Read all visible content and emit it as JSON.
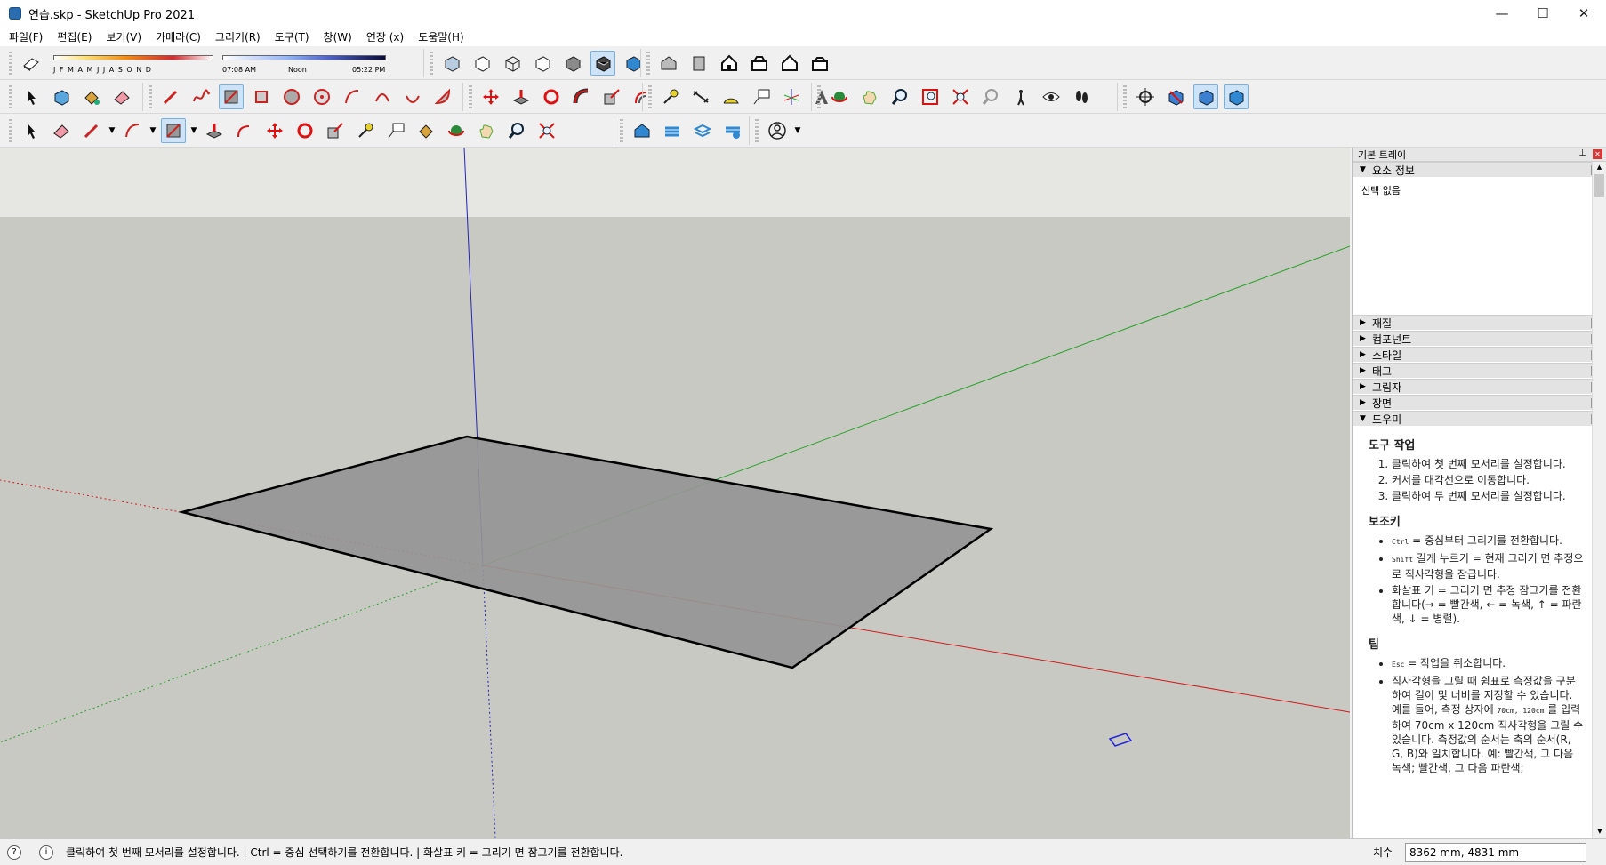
{
  "window": {
    "title": "연습.skp - SketchUp Pro 2021",
    "minimize": "—",
    "maximize": "☐",
    "close": "✕"
  },
  "menu": [
    "파일(F)",
    "편집(E)",
    "보기(V)",
    "카메라(C)",
    "그리기(R)",
    "도구(T)",
    "창(W)",
    "연장 (x)",
    "도움말(H)"
  ],
  "shadow": {
    "months": "J F M A M J J A S O N D",
    "time_start": "07:08 AM",
    "time_mid": "Noon",
    "time_end": "05:22 PM"
  },
  "tray": {
    "title": "기본 트레이",
    "pin": "⊥",
    "entity_info": {
      "label": "요소 정보",
      "content": "선택 없음"
    },
    "panels": [
      "재질",
      "컴포넌트",
      "스타일",
      "태그",
      "그림자",
      "장면"
    ],
    "instructor": {
      "label": "도우미"
    }
  },
  "help": {
    "h_tool": "도구 작업",
    "steps": [
      "클릭하여 첫 번째 모서리를 설정합니다.",
      "커서를 대각선으로 이동합니다.",
      "클릭하여 두 번째 모서리를 설정합니다."
    ],
    "h_mod": "보조키",
    "mod1_key": "Ctrl",
    "mod1_text": " = 중심부터 그리기를 전환합니다.",
    "mod2_key": "Shift",
    "mod2_text": " 길게 누르기 = 현재 그리기 면 추정으로 직사각형을 잠급니다.",
    "mod3_text": "화살표 키 = 그리기 면 추정 잠그기를 전환합니다(→ = 빨간색, ← = 녹색, ↑ = 파란색, ↓ = 병렬).",
    "h_tip": "팁",
    "tip1_key": "Esc",
    "tip1_text": " = 작업을 취소합니다.",
    "tip2_a": "직사각형을 그릴 때 쉼표로 측정값을 구분하여 길이 및 너비를 지정할 수 있습니다. 예를 들어, 측정 상자에 ",
    "tip2_k1": "70cm, 120cm",
    "tip2_b": " 를 입력하여 70cm x 120cm 직사각형을 그릴 수 있습니다. 측정값의 순서는 축의 순서(R, G, B)와 일치합니다. 예: 빨간색, 그 다음 녹색; 빨간색, 그 다음 파란색;"
  },
  "status": {
    "text": "클릭하여 첫 번째 모서리를 설정합니다. | Ctrl = 중심 선택하기를 전환합니다. | 화살표 키 = 그리기 면 잠그기를 전환합니다.",
    "measure_label": "치수",
    "measure_value": "8362 mm, 4831 mm"
  },
  "colors": {
    "axis_red": "#d21a1a",
    "axis_green": "#2aa12a",
    "axis_blue": "#2424b8",
    "sky": "#e6e6e3",
    "ground": "#c9c9c4",
    "face": "#959595"
  }
}
